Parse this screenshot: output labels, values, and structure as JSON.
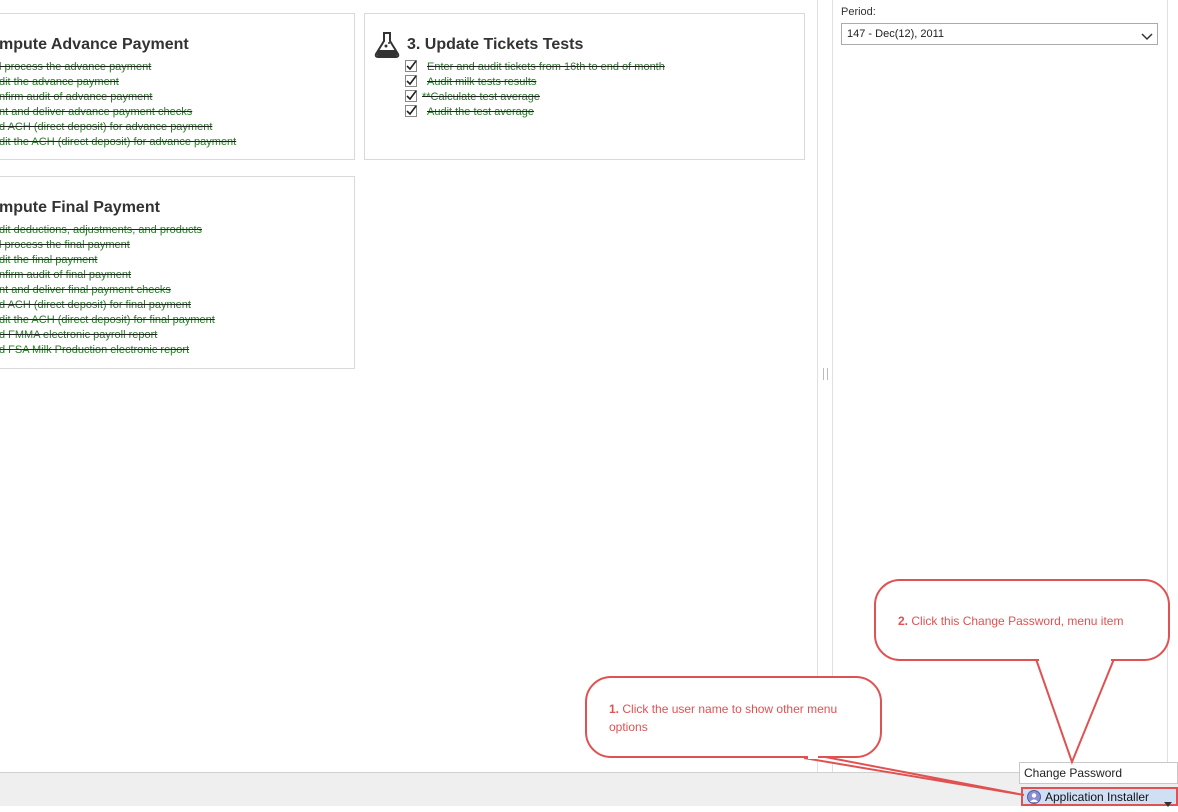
{
  "cards": [
    {
      "title": "mpute Advance Payment",
      "tasks": [
        "l process the advance payment",
        "dit the advance payment",
        "nfirm audit of advance payment",
        "nt and deliver advance payment checks",
        "d ACH (direct deposit) for advance payment",
        "dit the ACH (direct deposit) for advance payment"
      ]
    },
    {
      "title": "3. Update Tickets Tests",
      "icon": "flask-icon",
      "tasks": [
        " Enter and audit tickets from 16th to end of month",
        " Audit milk tests results",
        "**Calculate test average",
        " Audit the test average"
      ]
    },
    {
      "title": "mpute Final Payment",
      "tasks": [
        "dit deductions, adjustments, and products",
        "l process the final payment",
        "dit the final payment",
        "nfirm audit of final payment",
        "nt and deliver final payment checks",
        "d ACH (direct deposit) for final payment",
        "dit the ACH (direct deposit) for final payment",
        "d FMMA electronic payroll report",
        "d FSA Milk Production electronic report"
      ]
    }
  ],
  "sidebar": {
    "period_label": "Period:",
    "period_value": "147 - Dec(12), 2011"
  },
  "statusbar": {
    "user_name": "Application Installer",
    "menu": {
      "change_password": "Change Password"
    }
  },
  "callouts": [
    {
      "number": "1.",
      "text": "Click the user name to show other menu options"
    },
    {
      "number": "2.",
      "text": "Click this Change Password, menu item"
    }
  ],
  "colors": {
    "callout_red": "#e05252",
    "task_green": "#2a7a2a",
    "user_button_bg": "#cfe0f5"
  }
}
